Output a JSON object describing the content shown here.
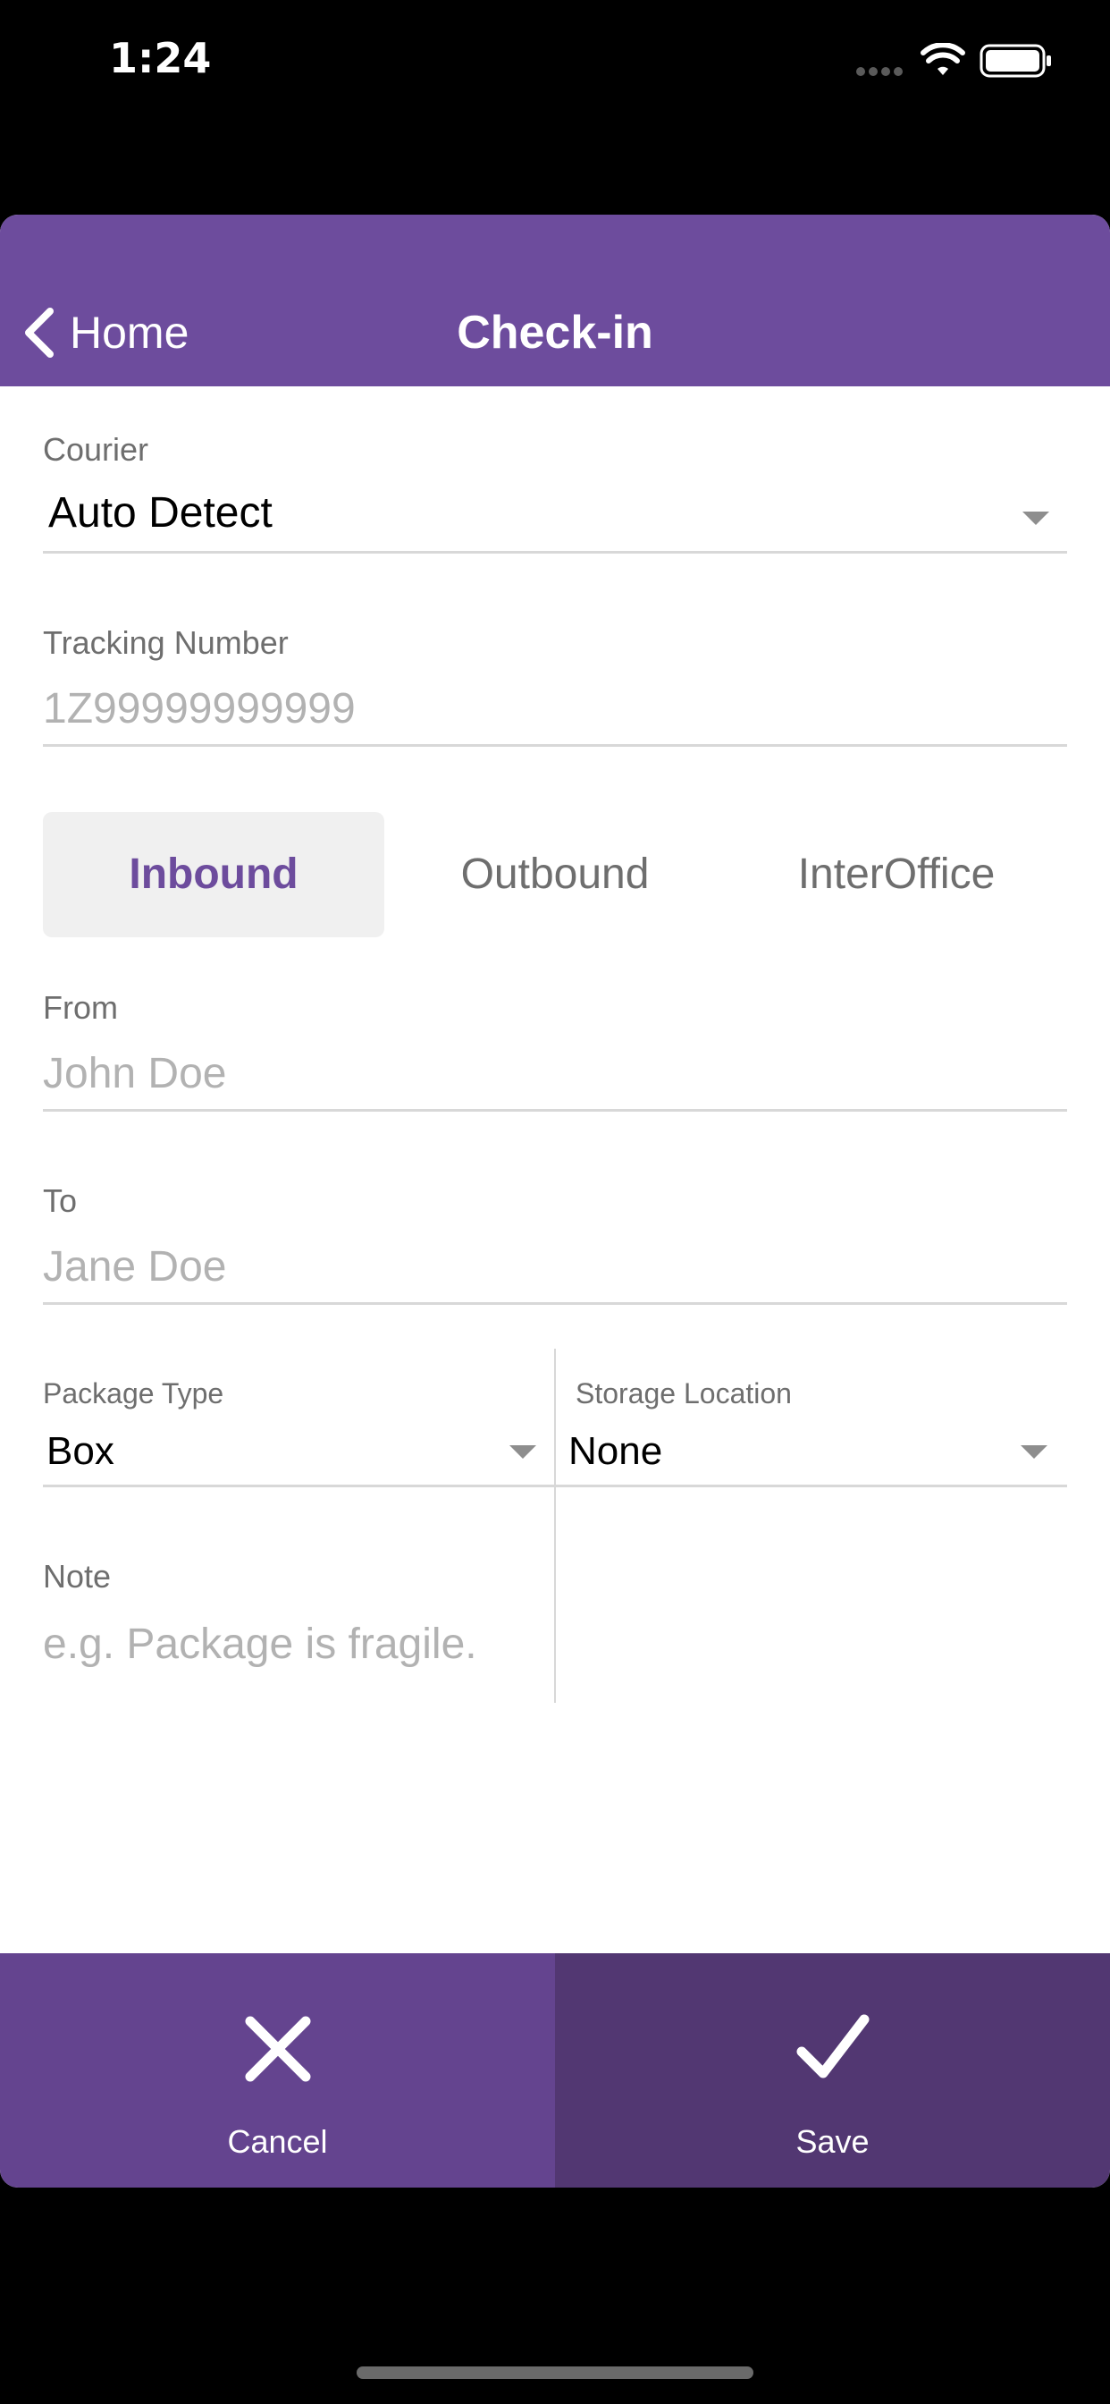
{
  "status_bar": {
    "time": "1:24"
  },
  "nav": {
    "back_label": "Home",
    "title": "Check-in"
  },
  "courier": {
    "label": "Courier",
    "value": "Auto Detect"
  },
  "tracking": {
    "label": "Tracking Number",
    "placeholder": "1Z99999999999"
  },
  "direction": {
    "segments": [
      "Inbound",
      "Outbound",
      "InterOffice"
    ],
    "selected": "Inbound"
  },
  "from": {
    "label": "From",
    "placeholder": "John Doe"
  },
  "to": {
    "label": "To",
    "placeholder": "Jane Doe"
  },
  "package_type": {
    "label": "Package Type",
    "value": "Box"
  },
  "storage_location": {
    "label": "Storage Location",
    "value": "None"
  },
  "note": {
    "label": "Note",
    "placeholder": "e.g. Package is fragile."
  },
  "actions": {
    "cancel_label": "Cancel",
    "save_label": "Save"
  },
  "colors": {
    "brand": "#6d4c9d",
    "cancel_bg": "#64448f",
    "save_bg": "#523772",
    "label_gray": "#6e6e6e",
    "placeholder_gray": "#b2b2b2"
  }
}
